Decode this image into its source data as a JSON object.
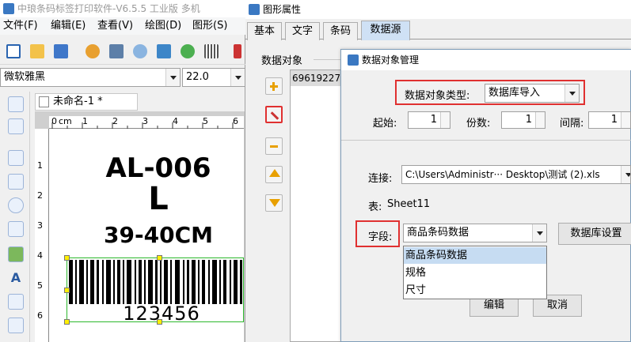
{
  "main_window": {
    "title": "中琅条码标签打印软件-V6.5.5 工业版 多机",
    "menus": [
      "文件(F)",
      "编辑(E)",
      "查看(V)",
      "绘图(D)",
      "图形(S)"
    ],
    "font_name": "微软雅黑",
    "font_size": "22.0",
    "doc_tab": "未命名-1 *",
    "ruler_h": [
      "0",
      "cm",
      "1",
      "2",
      "3",
      "4",
      "5",
      "6"
    ],
    "ruler_v": [
      "1",
      "2",
      "3",
      "4",
      "5",
      "6"
    ],
    "label": {
      "line1": "AL-006",
      "line2": "L",
      "line3": "39-40CM",
      "barcode_text": "123456"
    }
  },
  "prop_window": {
    "title": "图形属性",
    "tabs": [
      "基本",
      "文字",
      "条码",
      "数据源"
    ],
    "active_tab": "数据源",
    "data_object_label": "数据对象",
    "data_object_value": "69619227"
  },
  "dialog": {
    "title": "数据对象管理",
    "type_label": "数据对象类型:",
    "type_value": "数据库导入",
    "start_label": "起始:",
    "start_value": "1",
    "copies_label": "份数:",
    "copies_value": "1",
    "interval_label": "间隔:",
    "interval_value": "1",
    "connect_label": "连接:",
    "connect_value": "C:\\Users\\Administr··· Desktop\\测试 (2).xls",
    "table_label": "表:",
    "table_value": "Sheet11",
    "field_label": "字段:",
    "field_value": "商品条码数据",
    "db_settings_button": "数据库设置",
    "field_options": [
      "商品条码数据",
      "规格",
      "尺寸"
    ],
    "ok_button": "编辑",
    "cancel_button": "取消"
  },
  "colors": {
    "highlight_red": "#e03030",
    "selection_green": "#2db82d",
    "tab_active": "#cfe1f5",
    "list_selected": "#c6dcf2"
  }
}
